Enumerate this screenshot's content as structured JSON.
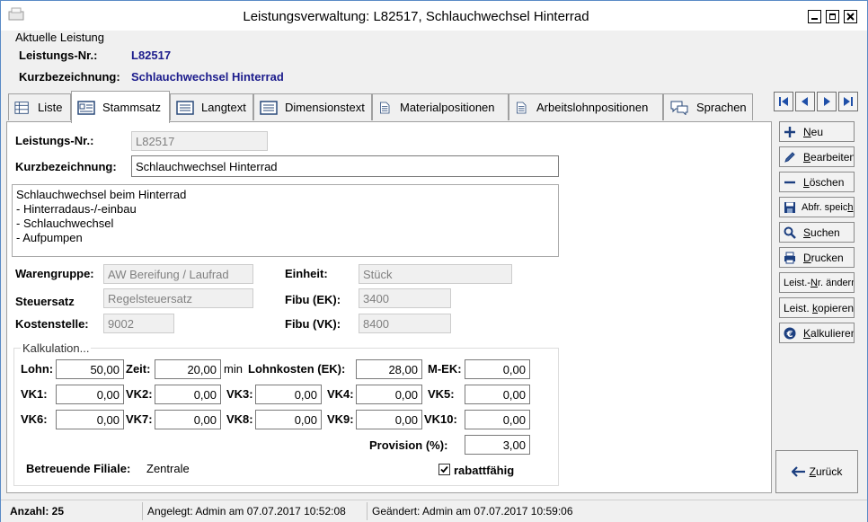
{
  "window": {
    "title": "Leistungsverwaltung: L82517, Schlauchwechsel Hinterrad"
  },
  "header": {
    "group_label": "Aktuelle Leistung",
    "nr_label": "Leistungs-Nr.:",
    "nr_value": "L82517",
    "kurz_label": "Kurzbezeichnung:",
    "kurz_value": "Schlauchwechsel Hinterrad"
  },
  "tabs": [
    {
      "label": "Liste"
    },
    {
      "label": "Stammsatz"
    },
    {
      "label": "Langtext"
    },
    {
      "label": "Dimensionstext"
    },
    {
      "label": "Materialpositionen"
    },
    {
      "label": "Arbeitslohnpositionen"
    },
    {
      "label": "Sprachen"
    }
  ],
  "active_tab": "Stammsatz",
  "form": {
    "nr_label": "Leistungs-Nr.:",
    "nr_value": "L82517",
    "kurz_label": "Kurzbezeichnung:",
    "kurz_value": "Schlauchwechsel Hinterrad",
    "description": "Schlauchwechsel beim Hinterrad\n- Hinterradaus-/-einbau\n- Schlauchwechsel\n- Aufpumpen",
    "warengruppe_label": "Warengruppe:",
    "warengruppe_value": "AW Bereifung / Laufrad",
    "steuersatz_label": "Steuersatz",
    "steuersatz_value": "Regelsteuersatz",
    "kostenstelle_label": "Kostenstelle:",
    "kostenstelle_value": "9002",
    "einheit_label": "Einheit:",
    "einheit_value": "Stück",
    "fibu_ek_label": "Fibu (EK):",
    "fibu_ek_value": "3400",
    "fibu_vk_label": "Fibu (VK):",
    "fibu_vk_value": "8400"
  },
  "kalkulation": {
    "legend": "Kalkulation...",
    "lohn_label": "Lohn:",
    "lohn_value": "50,00",
    "zeit_label": "Zeit:",
    "zeit_value": "20,00",
    "zeit_unit": "min",
    "lohnkosten_label": "Lohnkosten (EK):",
    "lohnkosten_value": "28,00",
    "mek_label": "M-EK:",
    "mek_value": "0,00",
    "vk": [
      {
        "label": "VK1:",
        "value": "0,00"
      },
      {
        "label": "VK2:",
        "value": "0,00"
      },
      {
        "label": "VK3:",
        "value": "0,00"
      },
      {
        "label": "VK4:",
        "value": "0,00"
      },
      {
        "label": "VK5:",
        "value": "0,00"
      },
      {
        "label": "VK6:",
        "value": "0,00"
      },
      {
        "label": "VK7:",
        "value": "0,00"
      },
      {
        "label": "VK8:",
        "value": "0,00"
      },
      {
        "label": "VK9:",
        "value": "0,00"
      },
      {
        "label": "VK10:",
        "value": "0,00"
      }
    ],
    "provision_label": "Provision (%):",
    "provision_value": "3,00",
    "filiale_label": "Betreuende Filiale:",
    "filiale_value": "Zentrale",
    "rabatt_label": "rabattfähig",
    "rabatt_checked": true
  },
  "sidebar": {
    "buttons": [
      {
        "pre": "",
        "ul": "N",
        "post": "eu",
        "icon": "plus-icon"
      },
      {
        "pre": "",
        "ul": "B",
        "post": "earbeiten",
        "icon": "pencil-icon"
      },
      {
        "pre": "",
        "ul": "L",
        "post": "öschen",
        "icon": "minus-icon"
      },
      {
        "pre": "Abfr. speic",
        "ul": "h",
        "post": ".",
        "icon": "floppy-icon"
      },
      {
        "pre": "",
        "ul": "S",
        "post": "uchen",
        "icon": "magnifier-icon"
      },
      {
        "pre": "",
        "ul": "D",
        "post": "rucken",
        "icon": "printer-icon"
      },
      {
        "pre": "Leist.-",
        "ul": "N",
        "post": "r. ändern",
        "icon": ""
      },
      {
        "pre": "Leist. ",
        "ul": "k",
        "post": "opieren",
        "icon": ""
      },
      {
        "pre": "",
        "ul": "K",
        "post": "alkulieren",
        "icon": "euro-icon"
      }
    ],
    "back_pre": "",
    "back_ul": "Z",
    "back_post": "urück"
  },
  "status": {
    "count": "Anzahl: 25",
    "created": "Angelegt: Admin am 07.07.2017 10:52:08",
    "changed": "Geändert: Admin am 07.07.2017 10:59:06"
  },
  "colors": {
    "header_value": "#1c1c8c",
    "frame": "#5a8ac6"
  }
}
